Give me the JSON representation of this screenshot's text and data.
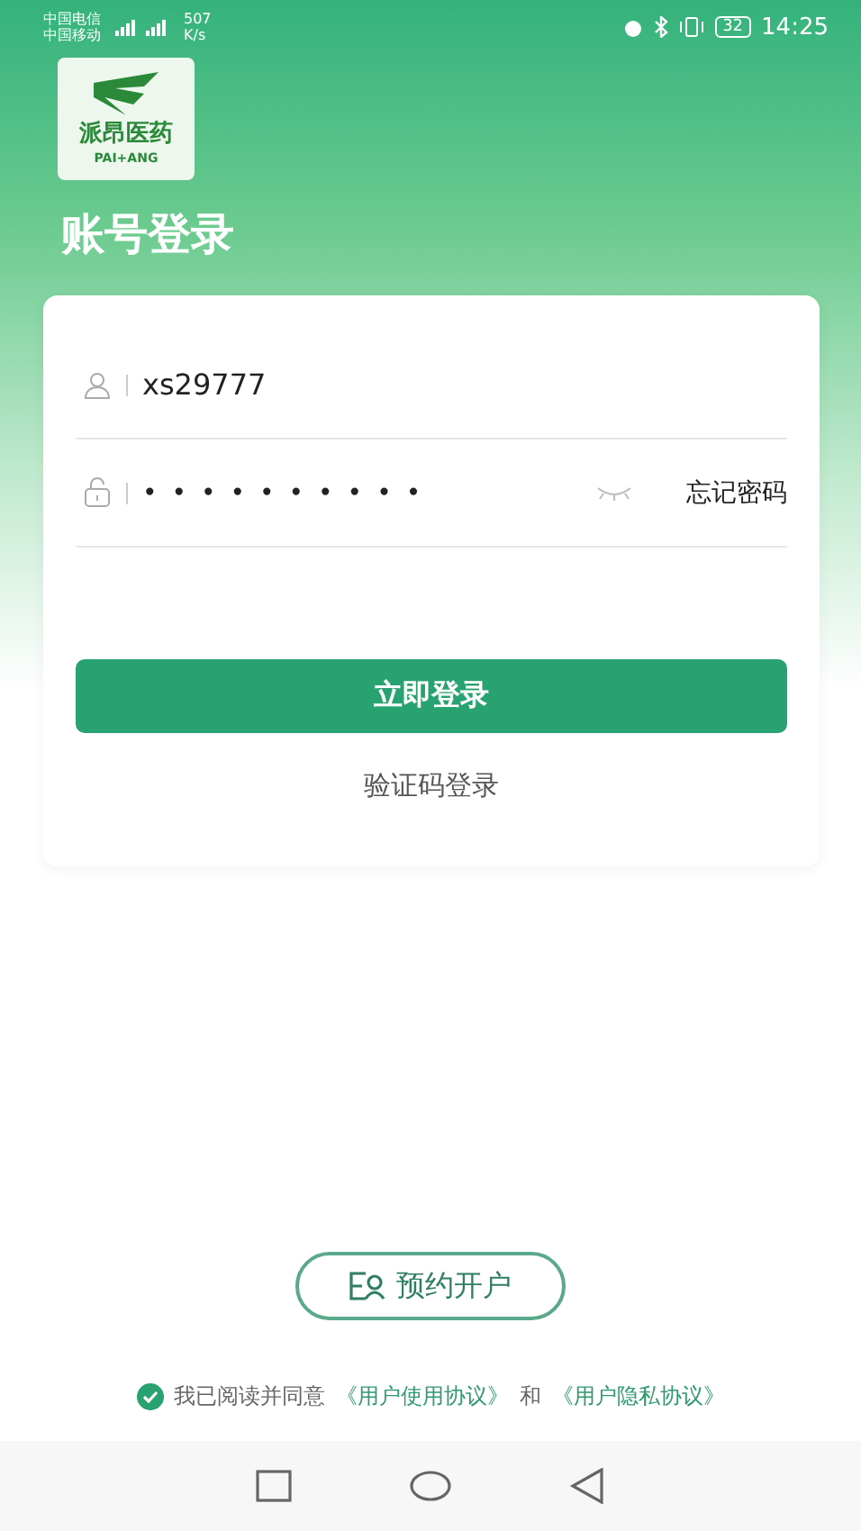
{
  "status_bar": {
    "carriers": [
      "中国电信",
      "中国移动"
    ],
    "speed": "507",
    "speed_unit": "K/s",
    "battery": "32",
    "time": "14:25"
  },
  "logo": {
    "name": "派昂医药",
    "latin": "PAI+ANG"
  },
  "title": "账号登录",
  "form": {
    "username": {
      "value": "xs29777"
    },
    "password": {
      "value": "••••••••••"
    },
    "forgot": "忘记密码",
    "login_button": "立即登录",
    "sms_login": "验证码登录"
  },
  "open_account_button": "预约开户",
  "agreement": {
    "checked": true,
    "text": "我已阅读并同意",
    "link_1": "《用户使用协议》",
    "joiner": "和",
    "link_2": "《用户隐私协议》"
  }
}
